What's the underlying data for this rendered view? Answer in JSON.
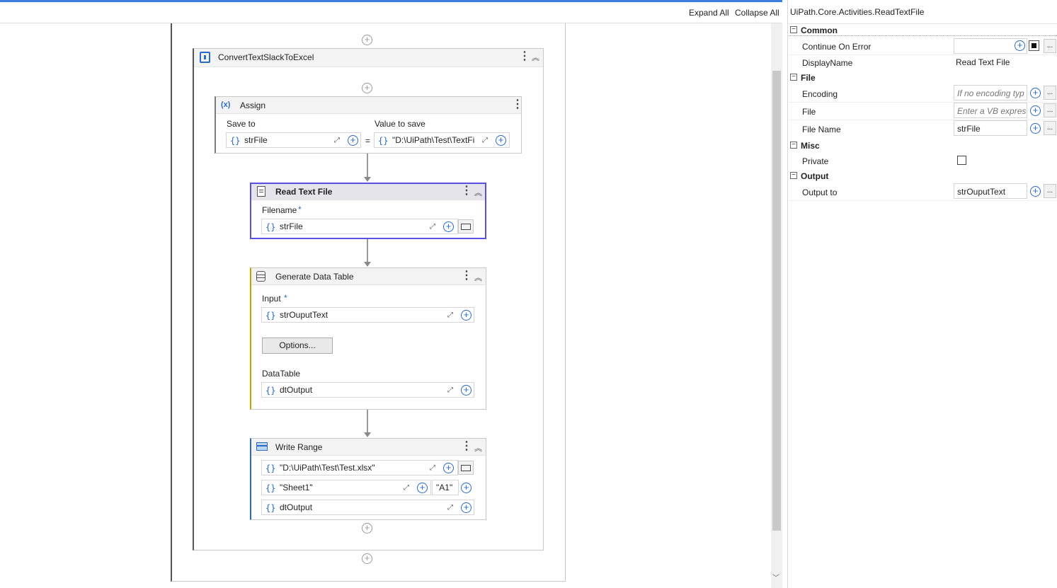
{
  "toolbar": {
    "expand_all": "Expand All",
    "collapse_all": "Collapse All"
  },
  "workflow": {
    "sequence_title": "ConvertTextSlackToExcel",
    "assign": {
      "title": "Assign",
      "save_to_label": "Save to",
      "value_label": "Value to save",
      "save_to_value": "strFile",
      "equals": "=",
      "value": "\"D:\\UiPath\\Test\\TextFi"
    },
    "read_text_file": {
      "title": "Read Text File",
      "filename_label": "Filename",
      "required": "*",
      "filename_value": "strFile"
    },
    "generate_data_table": {
      "title": "Generate Data Table",
      "input_label": "Input",
      "required": "*",
      "input_value": "strOuputText",
      "options_button": "Options...",
      "datatable_label": "DataTable",
      "datatable_value": "dtOutput"
    },
    "write_range": {
      "title": "Write Range",
      "workbook_value": "\"D:\\UiPath\\Test\\Test.xlsx\"",
      "sheet_value": "\"Sheet1\"",
      "cell_value": "\"A1\"",
      "datatable_value": "dtOutput"
    },
    "brace": "{}"
  },
  "properties": {
    "header": "UiPath.Core.Activities.ReadTextFile",
    "categories": {
      "common": "Common",
      "file": "File",
      "misc": "Misc",
      "output": "Output"
    },
    "continue_on_error": "Continue On Error",
    "display_name_label": "DisplayName",
    "display_name_value": "Read Text File",
    "encoding_label": "Encoding",
    "encoding_hint": "If no encoding type",
    "file_label": "File",
    "file_hint": "Enter a VB express",
    "file_name_label": "File Name",
    "file_name_value": "strFile",
    "private_label": "Private",
    "output_to_label": "Output to",
    "output_to_value": "strOuputText",
    "more": "..."
  },
  "colors": {
    "selection": "#5a4fe0",
    "accent": "#2a6ac8",
    "assign_stripe": "#7a7a7a",
    "gdt_stripe": "#c8a000",
    "wr_stripe": "#2a6ac8"
  }
}
